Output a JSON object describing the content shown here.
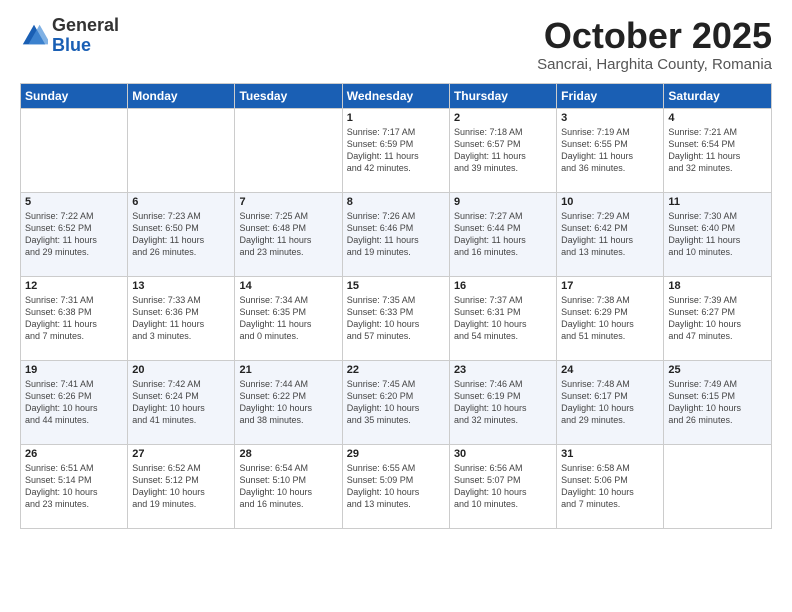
{
  "logo": {
    "general": "General",
    "blue": "Blue"
  },
  "title": "October 2025",
  "subtitle": "Sancrai, Harghita County, Romania",
  "days_of_week": [
    "Sunday",
    "Monday",
    "Tuesday",
    "Wednesday",
    "Thursday",
    "Friday",
    "Saturday"
  ],
  "weeks": [
    [
      {
        "day": "",
        "info": ""
      },
      {
        "day": "",
        "info": ""
      },
      {
        "day": "",
        "info": ""
      },
      {
        "day": "1",
        "info": "Sunrise: 7:17 AM\nSunset: 6:59 PM\nDaylight: 11 hours\nand 42 minutes."
      },
      {
        "day": "2",
        "info": "Sunrise: 7:18 AM\nSunset: 6:57 PM\nDaylight: 11 hours\nand 39 minutes."
      },
      {
        "day": "3",
        "info": "Sunrise: 7:19 AM\nSunset: 6:55 PM\nDaylight: 11 hours\nand 36 minutes."
      },
      {
        "day": "4",
        "info": "Sunrise: 7:21 AM\nSunset: 6:54 PM\nDaylight: 11 hours\nand 32 minutes."
      }
    ],
    [
      {
        "day": "5",
        "info": "Sunrise: 7:22 AM\nSunset: 6:52 PM\nDaylight: 11 hours\nand 29 minutes."
      },
      {
        "day": "6",
        "info": "Sunrise: 7:23 AM\nSunset: 6:50 PM\nDaylight: 11 hours\nand 26 minutes."
      },
      {
        "day": "7",
        "info": "Sunrise: 7:25 AM\nSunset: 6:48 PM\nDaylight: 11 hours\nand 23 minutes."
      },
      {
        "day": "8",
        "info": "Sunrise: 7:26 AM\nSunset: 6:46 PM\nDaylight: 11 hours\nand 19 minutes."
      },
      {
        "day": "9",
        "info": "Sunrise: 7:27 AM\nSunset: 6:44 PM\nDaylight: 11 hours\nand 16 minutes."
      },
      {
        "day": "10",
        "info": "Sunrise: 7:29 AM\nSunset: 6:42 PM\nDaylight: 11 hours\nand 13 minutes."
      },
      {
        "day": "11",
        "info": "Sunrise: 7:30 AM\nSunset: 6:40 PM\nDaylight: 11 hours\nand 10 minutes."
      }
    ],
    [
      {
        "day": "12",
        "info": "Sunrise: 7:31 AM\nSunset: 6:38 PM\nDaylight: 11 hours\nand 7 minutes."
      },
      {
        "day": "13",
        "info": "Sunrise: 7:33 AM\nSunset: 6:36 PM\nDaylight: 11 hours\nand 3 minutes."
      },
      {
        "day": "14",
        "info": "Sunrise: 7:34 AM\nSunset: 6:35 PM\nDaylight: 11 hours\nand 0 minutes."
      },
      {
        "day": "15",
        "info": "Sunrise: 7:35 AM\nSunset: 6:33 PM\nDaylight: 10 hours\nand 57 minutes."
      },
      {
        "day": "16",
        "info": "Sunrise: 7:37 AM\nSunset: 6:31 PM\nDaylight: 10 hours\nand 54 minutes."
      },
      {
        "day": "17",
        "info": "Sunrise: 7:38 AM\nSunset: 6:29 PM\nDaylight: 10 hours\nand 51 minutes."
      },
      {
        "day": "18",
        "info": "Sunrise: 7:39 AM\nSunset: 6:27 PM\nDaylight: 10 hours\nand 47 minutes."
      }
    ],
    [
      {
        "day": "19",
        "info": "Sunrise: 7:41 AM\nSunset: 6:26 PM\nDaylight: 10 hours\nand 44 minutes."
      },
      {
        "day": "20",
        "info": "Sunrise: 7:42 AM\nSunset: 6:24 PM\nDaylight: 10 hours\nand 41 minutes."
      },
      {
        "day": "21",
        "info": "Sunrise: 7:44 AM\nSunset: 6:22 PM\nDaylight: 10 hours\nand 38 minutes."
      },
      {
        "day": "22",
        "info": "Sunrise: 7:45 AM\nSunset: 6:20 PM\nDaylight: 10 hours\nand 35 minutes."
      },
      {
        "day": "23",
        "info": "Sunrise: 7:46 AM\nSunset: 6:19 PM\nDaylight: 10 hours\nand 32 minutes."
      },
      {
        "day": "24",
        "info": "Sunrise: 7:48 AM\nSunset: 6:17 PM\nDaylight: 10 hours\nand 29 minutes."
      },
      {
        "day": "25",
        "info": "Sunrise: 7:49 AM\nSunset: 6:15 PM\nDaylight: 10 hours\nand 26 minutes."
      }
    ],
    [
      {
        "day": "26",
        "info": "Sunrise: 6:51 AM\nSunset: 5:14 PM\nDaylight: 10 hours\nand 23 minutes."
      },
      {
        "day": "27",
        "info": "Sunrise: 6:52 AM\nSunset: 5:12 PM\nDaylight: 10 hours\nand 19 minutes."
      },
      {
        "day": "28",
        "info": "Sunrise: 6:54 AM\nSunset: 5:10 PM\nDaylight: 10 hours\nand 16 minutes."
      },
      {
        "day": "29",
        "info": "Sunrise: 6:55 AM\nSunset: 5:09 PM\nDaylight: 10 hours\nand 13 minutes."
      },
      {
        "day": "30",
        "info": "Sunrise: 6:56 AM\nSunset: 5:07 PM\nDaylight: 10 hours\nand 10 minutes."
      },
      {
        "day": "31",
        "info": "Sunrise: 6:58 AM\nSunset: 5:06 PM\nDaylight: 10 hours\nand 7 minutes."
      },
      {
        "day": "",
        "info": ""
      }
    ]
  ]
}
